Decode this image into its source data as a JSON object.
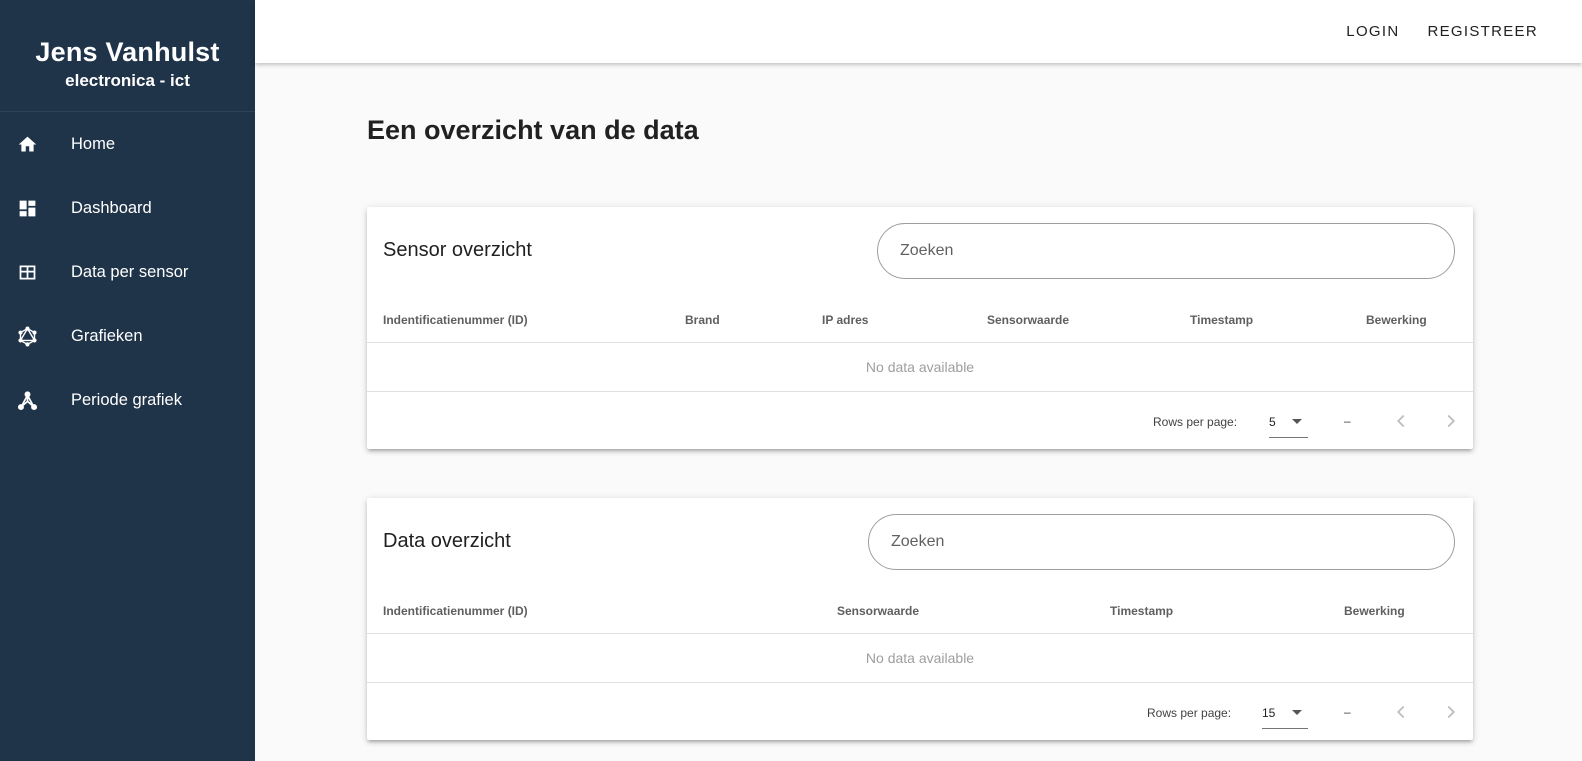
{
  "sidebar": {
    "brand_name": "Jens Vanhulst",
    "brand_sub": "electronica - ict",
    "items": [
      {
        "label": "Home",
        "icon": "home-icon"
      },
      {
        "label": "Dashboard",
        "icon": "dashboard-icon"
      },
      {
        "label": "Data per sensor",
        "icon": "table-icon"
      },
      {
        "label": "Grafieken",
        "icon": "graphql-icon"
      },
      {
        "label": "Periode grafiek",
        "icon": "hub-icon"
      }
    ],
    "bg_color": "#1f3349"
  },
  "topbar": {
    "login": "LOGIN",
    "register": "REGISTREER"
  },
  "main": {
    "page_title": "Een overzicht van de data"
  },
  "sensor_table": {
    "title": "Sensor overzicht",
    "search_placeholder": "Zoeken",
    "columns": [
      "Indentificatienummer (ID)",
      "Brand",
      "IP adres",
      "Sensorwaarde",
      "Timestamp",
      "Bewerking"
    ],
    "empty_text": "No data available",
    "rows_per_page_label": "Rows per page:",
    "rows_per_page": "5",
    "range_text": "–"
  },
  "data_table": {
    "title": "Data overzicht",
    "search_placeholder": "Zoeken",
    "columns": [
      "Indentificatienummer (ID)",
      "Sensorwaarde",
      "Timestamp",
      "Bewerking"
    ],
    "empty_text": "No data available",
    "rows_per_page_label": "Rows per page:",
    "rows_per_page": "15",
    "range_text": "–"
  }
}
